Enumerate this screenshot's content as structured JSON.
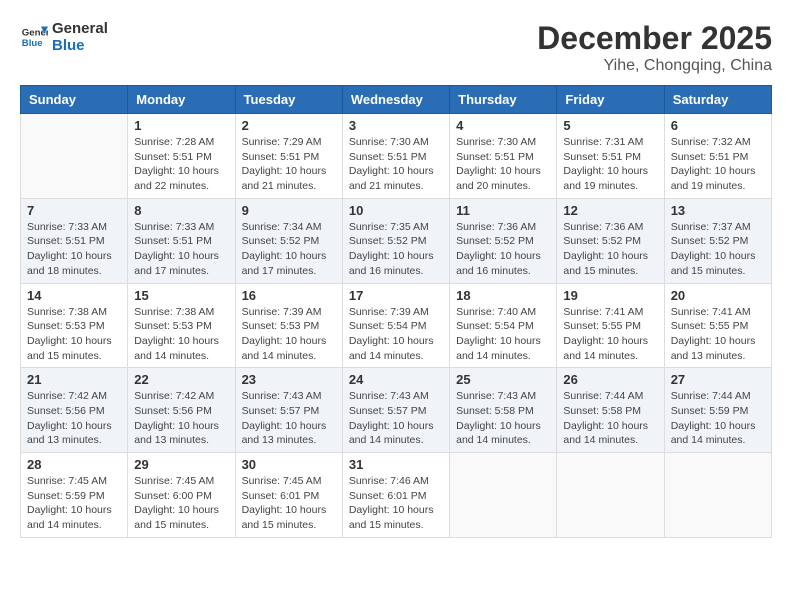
{
  "header": {
    "logo_line1": "General",
    "logo_line2": "Blue",
    "month": "December 2025",
    "location": "Yihe, Chongqing, China"
  },
  "weekdays": [
    "Sunday",
    "Monday",
    "Tuesday",
    "Wednesday",
    "Thursday",
    "Friday",
    "Saturday"
  ],
  "weeks": [
    [
      {
        "day": "",
        "info": ""
      },
      {
        "day": "1",
        "info": "Sunrise: 7:28 AM\nSunset: 5:51 PM\nDaylight: 10 hours and 22 minutes."
      },
      {
        "day": "2",
        "info": "Sunrise: 7:29 AM\nSunset: 5:51 PM\nDaylight: 10 hours and 21 minutes."
      },
      {
        "day": "3",
        "info": "Sunrise: 7:30 AM\nSunset: 5:51 PM\nDaylight: 10 hours and 21 minutes."
      },
      {
        "day": "4",
        "info": "Sunrise: 7:30 AM\nSunset: 5:51 PM\nDaylight: 10 hours and 20 minutes."
      },
      {
        "day": "5",
        "info": "Sunrise: 7:31 AM\nSunset: 5:51 PM\nDaylight: 10 hours and 19 minutes."
      },
      {
        "day": "6",
        "info": "Sunrise: 7:32 AM\nSunset: 5:51 PM\nDaylight: 10 hours and 19 minutes."
      }
    ],
    [
      {
        "day": "7",
        "info": "Sunrise: 7:33 AM\nSunset: 5:51 PM\nDaylight: 10 hours and 18 minutes."
      },
      {
        "day": "8",
        "info": "Sunrise: 7:33 AM\nSunset: 5:51 PM\nDaylight: 10 hours and 17 minutes."
      },
      {
        "day": "9",
        "info": "Sunrise: 7:34 AM\nSunset: 5:52 PM\nDaylight: 10 hours and 17 minutes."
      },
      {
        "day": "10",
        "info": "Sunrise: 7:35 AM\nSunset: 5:52 PM\nDaylight: 10 hours and 16 minutes."
      },
      {
        "day": "11",
        "info": "Sunrise: 7:36 AM\nSunset: 5:52 PM\nDaylight: 10 hours and 16 minutes."
      },
      {
        "day": "12",
        "info": "Sunrise: 7:36 AM\nSunset: 5:52 PM\nDaylight: 10 hours and 15 minutes."
      },
      {
        "day": "13",
        "info": "Sunrise: 7:37 AM\nSunset: 5:52 PM\nDaylight: 10 hours and 15 minutes."
      }
    ],
    [
      {
        "day": "14",
        "info": "Sunrise: 7:38 AM\nSunset: 5:53 PM\nDaylight: 10 hours and 15 minutes."
      },
      {
        "day": "15",
        "info": "Sunrise: 7:38 AM\nSunset: 5:53 PM\nDaylight: 10 hours and 14 minutes."
      },
      {
        "day": "16",
        "info": "Sunrise: 7:39 AM\nSunset: 5:53 PM\nDaylight: 10 hours and 14 minutes."
      },
      {
        "day": "17",
        "info": "Sunrise: 7:39 AM\nSunset: 5:54 PM\nDaylight: 10 hours and 14 minutes."
      },
      {
        "day": "18",
        "info": "Sunrise: 7:40 AM\nSunset: 5:54 PM\nDaylight: 10 hours and 14 minutes."
      },
      {
        "day": "19",
        "info": "Sunrise: 7:41 AM\nSunset: 5:55 PM\nDaylight: 10 hours and 14 minutes."
      },
      {
        "day": "20",
        "info": "Sunrise: 7:41 AM\nSunset: 5:55 PM\nDaylight: 10 hours and 13 minutes."
      }
    ],
    [
      {
        "day": "21",
        "info": "Sunrise: 7:42 AM\nSunset: 5:56 PM\nDaylight: 10 hours and 13 minutes."
      },
      {
        "day": "22",
        "info": "Sunrise: 7:42 AM\nSunset: 5:56 PM\nDaylight: 10 hours and 13 minutes."
      },
      {
        "day": "23",
        "info": "Sunrise: 7:43 AM\nSunset: 5:57 PM\nDaylight: 10 hours and 13 minutes."
      },
      {
        "day": "24",
        "info": "Sunrise: 7:43 AM\nSunset: 5:57 PM\nDaylight: 10 hours and 14 minutes."
      },
      {
        "day": "25",
        "info": "Sunrise: 7:43 AM\nSunset: 5:58 PM\nDaylight: 10 hours and 14 minutes."
      },
      {
        "day": "26",
        "info": "Sunrise: 7:44 AM\nSunset: 5:58 PM\nDaylight: 10 hours and 14 minutes."
      },
      {
        "day": "27",
        "info": "Sunrise: 7:44 AM\nSunset: 5:59 PM\nDaylight: 10 hours and 14 minutes."
      }
    ],
    [
      {
        "day": "28",
        "info": "Sunrise: 7:45 AM\nSunset: 5:59 PM\nDaylight: 10 hours and 14 minutes."
      },
      {
        "day": "29",
        "info": "Sunrise: 7:45 AM\nSunset: 6:00 PM\nDaylight: 10 hours and 15 minutes."
      },
      {
        "day": "30",
        "info": "Sunrise: 7:45 AM\nSunset: 6:01 PM\nDaylight: 10 hours and 15 minutes."
      },
      {
        "day": "31",
        "info": "Sunrise: 7:46 AM\nSunset: 6:01 PM\nDaylight: 10 hours and 15 minutes."
      },
      {
        "day": "",
        "info": ""
      },
      {
        "day": "",
        "info": ""
      },
      {
        "day": "",
        "info": ""
      }
    ]
  ]
}
